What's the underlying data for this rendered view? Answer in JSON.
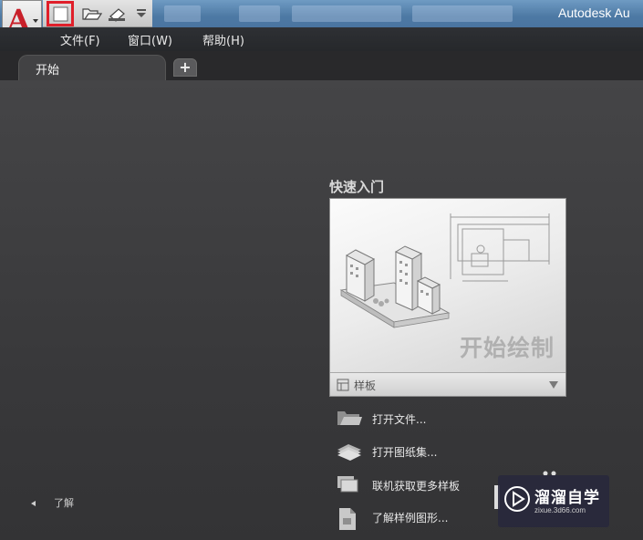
{
  "window": {
    "title": "Autodesk Au"
  },
  "quick_access": {
    "icons": [
      "new-document-icon",
      "open-folder-icon",
      "save-icon",
      "customize-dropdown-icon"
    ],
    "highlight_color": "#e01f2a"
  },
  "menubar": {
    "items": [
      {
        "label": "文件(F)"
      },
      {
        "label": "窗口(W)"
      },
      {
        "label": "帮助(H)"
      }
    ]
  },
  "tabs": {
    "items": [
      {
        "label": "开始"
      }
    ],
    "add_label": "+"
  },
  "start": {
    "section_title": "快速入门",
    "card": {
      "caption": "开始绘制",
      "template_label": "样板"
    },
    "actions": [
      {
        "label": "打开文件...",
        "icon": "open-folder-icon"
      },
      {
        "label": "打开图纸集...",
        "icon": "sheet-set-icon"
      },
      {
        "label": "联机获取更多样板",
        "icon": "online-templates-icon"
      },
      {
        "label": "了解样例图形...",
        "icon": "sample-drawings-icon"
      }
    ],
    "learn_label": "了解"
  },
  "watermark": {
    "brand": "溜溜自学",
    "url": "zixue.3d66.com"
  }
}
